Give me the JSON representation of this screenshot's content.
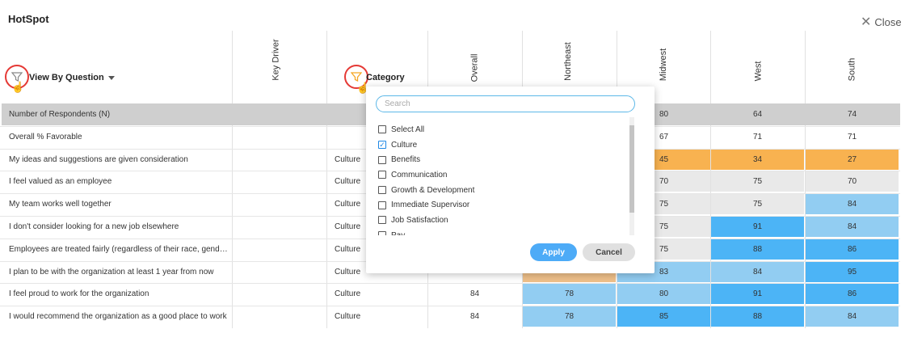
{
  "title": "HotSpot",
  "close_label": "Close",
  "header": {
    "view_by_label": "View By Question",
    "key_driver": "Key Driver",
    "category": "Category",
    "columns": [
      "Overall",
      "Northeast",
      "Midwest",
      "West",
      "South"
    ]
  },
  "rows": [
    {
      "question": "Number of Respondents (N)",
      "category": "",
      "values": [
        "",
        "",
        "80",
        "64",
        "74"
      ],
      "colors": [
        "",
        "",
        "",
        "",
        ""
      ]
    },
    {
      "question": "Overall % Favorable",
      "category": "",
      "values": [
        "",
        "",
        "67",
        "71",
        "71"
      ],
      "colors": [
        "",
        "",
        "",
        "",
        ""
      ]
    },
    {
      "question": "My ideas and suggestions are given consideration",
      "category": "Culture",
      "values": [
        "",
        "",
        "45",
        "34",
        "27"
      ],
      "colors": [
        "",
        "",
        "#f8b250",
        "#f8b250",
        "#f8b250"
      ]
    },
    {
      "question": "I feel valued as an employee",
      "category": "Culture",
      "values": [
        "",
        "",
        "70",
        "75",
        "70"
      ],
      "colors": [
        "",
        "",
        "#e9e9e9",
        "#e9e9e9",
        "#e9e9e9"
      ]
    },
    {
      "question": "My team works well together",
      "category": "Culture",
      "values": [
        "",
        "",
        "75",
        "75",
        "84"
      ],
      "colors": [
        "",
        "",
        "#e9e9e9",
        "#e9e9e9",
        "#92cdf2"
      ]
    },
    {
      "question": "I don't consider looking for a new job elsewhere",
      "category": "Culture",
      "values": [
        "",
        "",
        "75",
        "91",
        "84"
      ],
      "colors": [
        "",
        "",
        "#e9e9e9",
        "#4cb4f6",
        "#92cdf2"
      ]
    },
    {
      "question": "Employees are treated fairly (regardless of their race, gende...",
      "category": "Culture",
      "values": [
        "",
        "",
        "75",
        "88",
        "86"
      ],
      "colors": [
        "",
        "",
        "#e9e9e9",
        "#4cb4f6",
        "#4cb4f6"
      ]
    },
    {
      "question": "I plan to be with the organization at least 1 year from now",
      "category": "Culture",
      "values": [
        "",
        "",
        "83",
        "84",
        "95"
      ],
      "colors": [
        "",
        "#f0c18a",
        "#92cdf2",
        "#92cdf2",
        "#4cb4f6"
      ]
    },
    {
      "question": "I feel proud to work for the organization",
      "category": "Culture",
      "values": [
        "84",
        "78",
        "80",
        "91",
        "86"
      ],
      "colors": [
        "",
        "#92cdf2",
        "#92cdf2",
        "#4cb4f6",
        "#4cb4f6"
      ]
    },
    {
      "question": "I would recommend the organization as a good place to work",
      "category": "Culture",
      "values": [
        "84",
        "78",
        "85",
        "88",
        "84"
      ],
      "colors": [
        "",
        "#92cdf2",
        "#4cb4f6",
        "#4cb4f6",
        "#92cdf2"
      ]
    }
  ],
  "dropdown": {
    "search_placeholder": "Search",
    "options": [
      {
        "label": "Select All",
        "checked": false
      },
      {
        "label": "Culture",
        "checked": true
      },
      {
        "label": "Benefits",
        "checked": false
      },
      {
        "label": "Communication",
        "checked": false
      },
      {
        "label": "Growth & Development",
        "checked": false
      },
      {
        "label": "Immediate Supervisor",
        "checked": false
      },
      {
        "label": "Job Satisfaction",
        "checked": false
      },
      {
        "label": "Pay",
        "checked": false
      }
    ],
    "apply_label": "Apply",
    "cancel_label": "Cancel"
  },
  "colors": {
    "accent": "#4dabf7",
    "highlight_ring": "#e53935",
    "filter_active": "#f5a623",
    "header_row": "#cfcfcf"
  },
  "icons": {
    "close": "close-icon",
    "filter": "filter-icon",
    "pointer": "hand-pointer-icon",
    "caret": "caret-down-icon",
    "check": "check-icon"
  }
}
